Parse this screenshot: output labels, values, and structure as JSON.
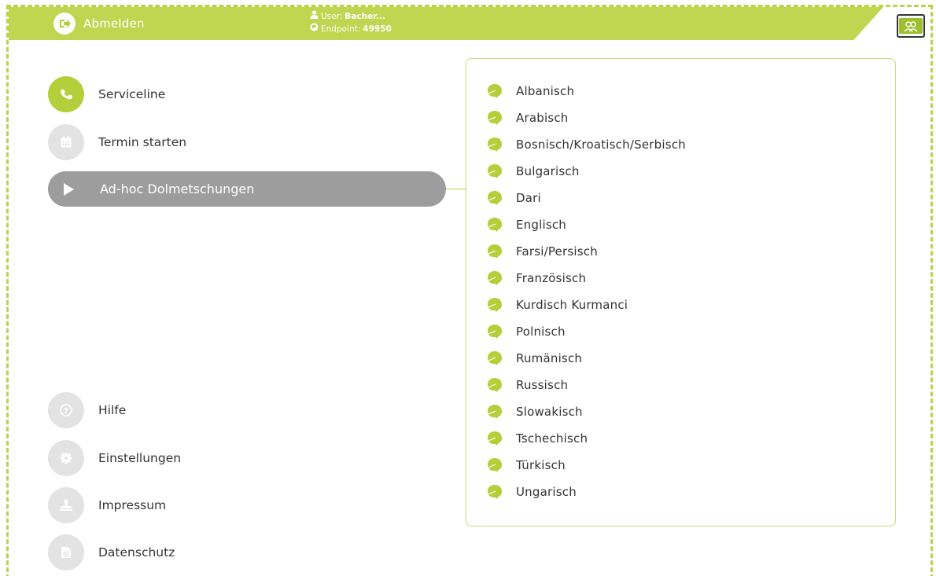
{
  "header": {
    "logout_label": "Abmelden",
    "user_label": "User:",
    "user_value": "Bacher...",
    "endpoint_label": "Endpoint:",
    "endpoint_value": "49950"
  },
  "colors": {
    "accent": "#c0d550",
    "active_nav": "#9d9d9d",
    "inactive_circle": "#e3e3e3"
  },
  "nav": {
    "serviceline": "Serviceline",
    "termin": "Termin starten",
    "adhoc": "Ad-hoc Dolmetschungen",
    "hilfe": "Hilfe",
    "einstellungen": "Einstellungen",
    "impressum": "Impressum",
    "datenschutz": "Datenschutz"
  },
  "languages": [
    "Albanisch",
    "Arabisch",
    "Bosnisch/Kroatisch/Serbisch",
    "Bulgarisch",
    "Dari",
    "Englisch",
    "Farsi/Persisch",
    "Französisch",
    "Kurdisch Kurmanci",
    "Polnisch",
    "Rumänisch",
    "Russisch",
    "Slowakisch",
    "Tschechisch",
    "Türkisch",
    "Ungarisch"
  ]
}
